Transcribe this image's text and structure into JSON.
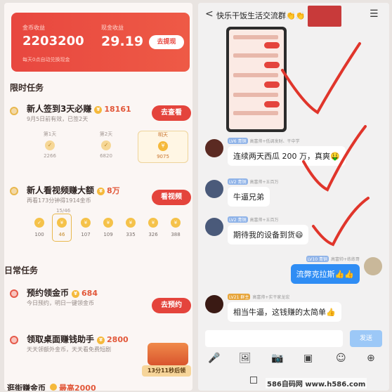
{
  "left": {
    "coin_label": "金币收益",
    "coin_value": "2203200",
    "cash_label": "现金收益",
    "cash_value": "29.19",
    "withdraw_button": "去提现",
    "auto_note": "每天0点自动兑换现金",
    "limited_section": "限时任务",
    "task1_title": "新人签到3天必赚",
    "task1_reward": "18161",
    "task1_sub": "9月5日前有效，已签2天",
    "task1_button": "去查看",
    "days": [
      {
        "label": "第1天",
        "value": "2266"
      },
      {
        "label": "第2天",
        "value": "6820"
      },
      {
        "label": "明天",
        "value": "9075"
      }
    ],
    "task2_title": "新人看视频赚大额",
    "task2_reward": "8万",
    "task2_sub": "再看173分钟得1914金币",
    "task2_button": "看视频",
    "task2_progress": "15/46",
    "stages": [
      "100",
      "46",
      "107",
      "109",
      "335",
      "326",
      "388"
    ],
    "daily_section": "日常任务",
    "task3_title": "预约领金币",
    "task3_reward": "684",
    "task3_sub": "今日预约，明日一键领金币",
    "task3_button": "去预约",
    "task4_title": "领取桌面赚钱助手",
    "task4_reward": "2800",
    "task4_sub": "天天领额外金币，天天看免费短剧",
    "timer": "13分11秒后领",
    "task5_title": "逛街赚金币",
    "task5_reward": "最高2000"
  },
  "right": {
    "title": "快乐干饭生活交流群",
    "title_emoji": "👏👏",
    "messages": [
      {
        "meta_level": "LV6 青铜",
        "meta_name": "高富帅+低调发财、干中学",
        "text": "连续两天西瓜 200 万，真爽🤑"
      },
      {
        "meta_level": "LV2 青铜",
        "meta_name": "高富帅+五百万",
        "text": "牛逼兄弟"
      },
      {
        "meta_level": "LV2 青铜",
        "meta_name": "高富帅+五百万",
        "text": "期待我的设备到货😄"
      },
      {
        "meta_level": "LV10 青铜",
        "meta_name": "高富帅+练练哥",
        "text": "流弊克拉斯👍👍"
      },
      {
        "meta_level": "LV21 群主",
        "meta_name": "高富帅+实干家龙宏",
        "text": "相当牛逼，这钱赚的太简单👍"
      }
    ],
    "send_button": "发送",
    "toolbar_icons": [
      "mic-icon",
      "image-icon",
      "camera-icon",
      "box-icon",
      "emoji-icon",
      "plus-icon"
    ]
  },
  "watermark": "586自码网 www.h586.com",
  "tick_color": "#e0352b"
}
